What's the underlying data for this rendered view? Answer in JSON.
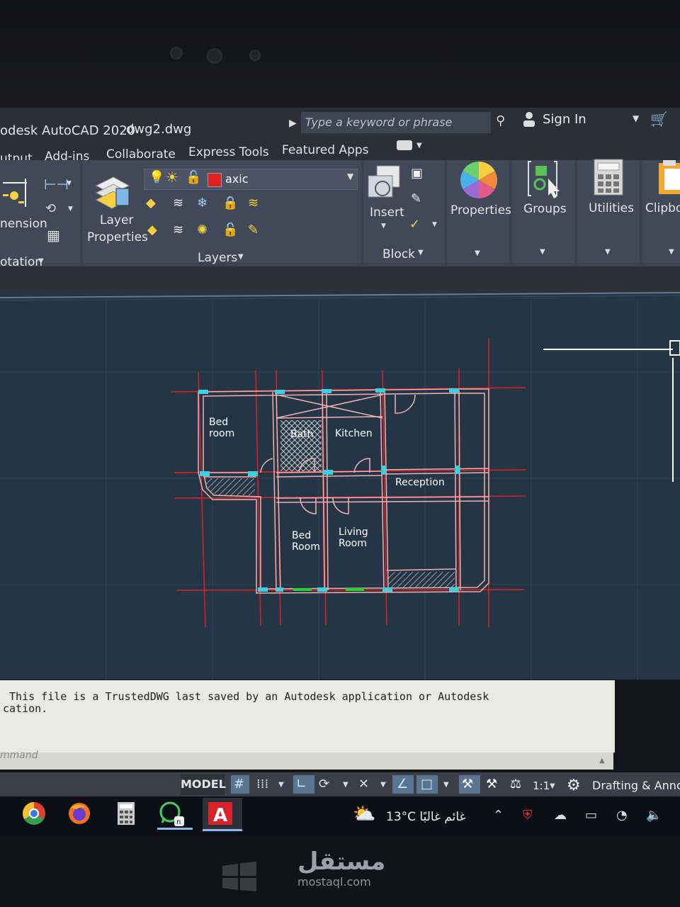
{
  "window": {
    "app_title": "odesk AutoCAD 2020",
    "file_name": "dwg2.dwg",
    "search_placeholder": "Type a keyword or phrase",
    "sign_in": "Sign In"
  },
  "tabs": [
    "utput",
    "Add-ins",
    "Collaborate",
    "Express Tools",
    "Featured Apps"
  ],
  "ribbon": {
    "annotation": {
      "label": "nension",
      "title": "otation"
    },
    "layers": {
      "big_button": [
        "Layer",
        "Properties"
      ],
      "current_layer": "axic",
      "title": "Layers"
    },
    "block": {
      "insert": "Insert",
      "title": "Block"
    },
    "properties": "Properties",
    "groups": "Groups",
    "utilities": "Utilities",
    "clipboard": "Clipbo"
  },
  "drawing": {
    "rooms": {
      "bed_room_1": [
        "Bed",
        "room"
      ],
      "bath": "Bath",
      "kitchen": "Kitchen",
      "reception": "Reception",
      "bed_room_2": [
        "Bed",
        "Room"
      ],
      "living_room": [
        "Living",
        "Room"
      ]
    }
  },
  "command": {
    "line1": " This file is a TrustedDWG last saved by an Autodesk application or Autodesk",
    "line2": "cation.",
    "placeholder": "mmand"
  },
  "status": {
    "model": "MODEL",
    "scale": "1:1",
    "workspace": "Drafting & Anno"
  },
  "taskbar": {
    "weather": "13°C غائم غالبًا"
  },
  "watermark": {
    "arabic": "مستقل",
    "latin": "mostaql.com"
  },
  "colors": {
    "grid_line": "#e02020",
    "wall": "#f0b0b0",
    "door_cyan": "#3ad0e0",
    "layer_swatch": "#e02020"
  }
}
